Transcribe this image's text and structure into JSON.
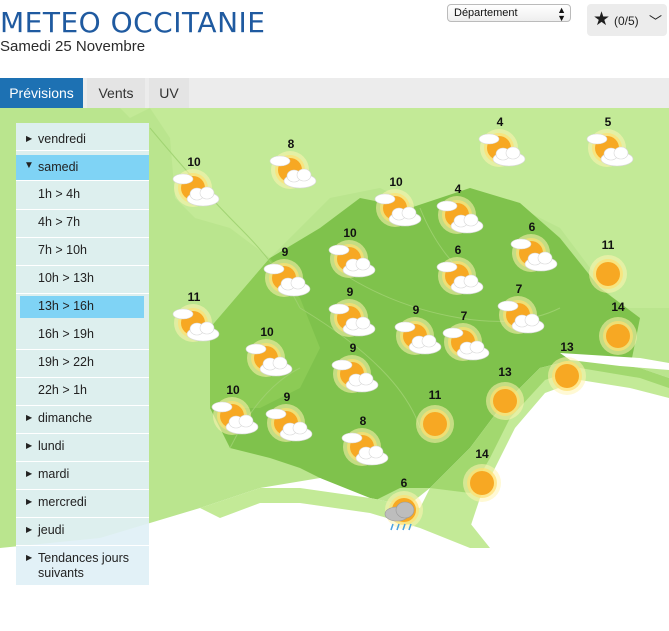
{
  "header": {
    "title": "METEO OCCITANIE",
    "date": "Samedi 25 Novembre",
    "select_value": "Département",
    "favorites_count": "(0/5)"
  },
  "tabs": [
    {
      "label": "Prévisions",
      "active": true
    },
    {
      "label": "Vents",
      "active": false
    },
    {
      "label": "UV",
      "active": false
    }
  ],
  "panel": {
    "days_before": [
      {
        "label": "vendredi"
      }
    ],
    "current_day": {
      "label": "samedi"
    },
    "slots": [
      {
        "label": "1h > 4h",
        "selected": false
      },
      {
        "label": "4h > 7h",
        "selected": false
      },
      {
        "label": "7h > 10h",
        "selected": false
      },
      {
        "label": "10h > 13h",
        "selected": false
      },
      {
        "label": "13h > 16h",
        "selected": true
      },
      {
        "label": "16h > 19h",
        "selected": false
      },
      {
        "label": "19h > 22h",
        "selected": false
      },
      {
        "label": "22h > 1h",
        "selected": false
      }
    ],
    "days_after": [
      {
        "label": "dimanche"
      },
      {
        "label": "lundi"
      },
      {
        "label": "mardi"
      },
      {
        "label": "mercredi"
      },
      {
        "label": "jeudi"
      },
      {
        "label": "Tendances jours suivants"
      }
    ]
  },
  "forecasts": [
    {
      "temp": "10",
      "icon": "sun-cloud"
    },
    {
      "temp": "8",
      "icon": "sun-cloud"
    },
    {
      "temp": "4",
      "icon": "sun-cloud"
    },
    {
      "temp": "5",
      "icon": "sun-cloud"
    },
    {
      "temp": "10",
      "icon": "sun-cloud"
    },
    {
      "temp": "4",
      "icon": "sun-cloud"
    },
    {
      "temp": "10",
      "icon": "sun-cloud"
    },
    {
      "temp": "6",
      "icon": "sun-cloud"
    },
    {
      "temp": "6",
      "icon": "sun-cloud"
    },
    {
      "temp": "9",
      "icon": "sun-cloud"
    },
    {
      "temp": "11",
      "icon": "sun"
    },
    {
      "temp": "9",
      "icon": "sun-cloud"
    },
    {
      "temp": "7",
      "icon": "sun-cloud"
    },
    {
      "temp": "11",
      "icon": "sun-cloud"
    },
    {
      "temp": "9",
      "icon": "sun-cloud"
    },
    {
      "temp": "7",
      "icon": "sun-cloud"
    },
    {
      "temp": "14",
      "icon": "sun"
    },
    {
      "temp": "10",
      "icon": "sun-cloud"
    },
    {
      "temp": "9",
      "icon": "sun-cloud"
    },
    {
      "temp": "13",
      "icon": "sun"
    },
    {
      "temp": "13",
      "icon": "sun"
    },
    {
      "temp": "10",
      "icon": "sun-cloud"
    },
    {
      "temp": "9",
      "icon": "sun-cloud"
    },
    {
      "temp": "11",
      "icon": "sun"
    },
    {
      "temp": "8",
      "icon": "sun-cloud"
    },
    {
      "temp": "14",
      "icon": "sun"
    },
    {
      "temp": "6",
      "icon": "sun-rain"
    }
  ]
}
